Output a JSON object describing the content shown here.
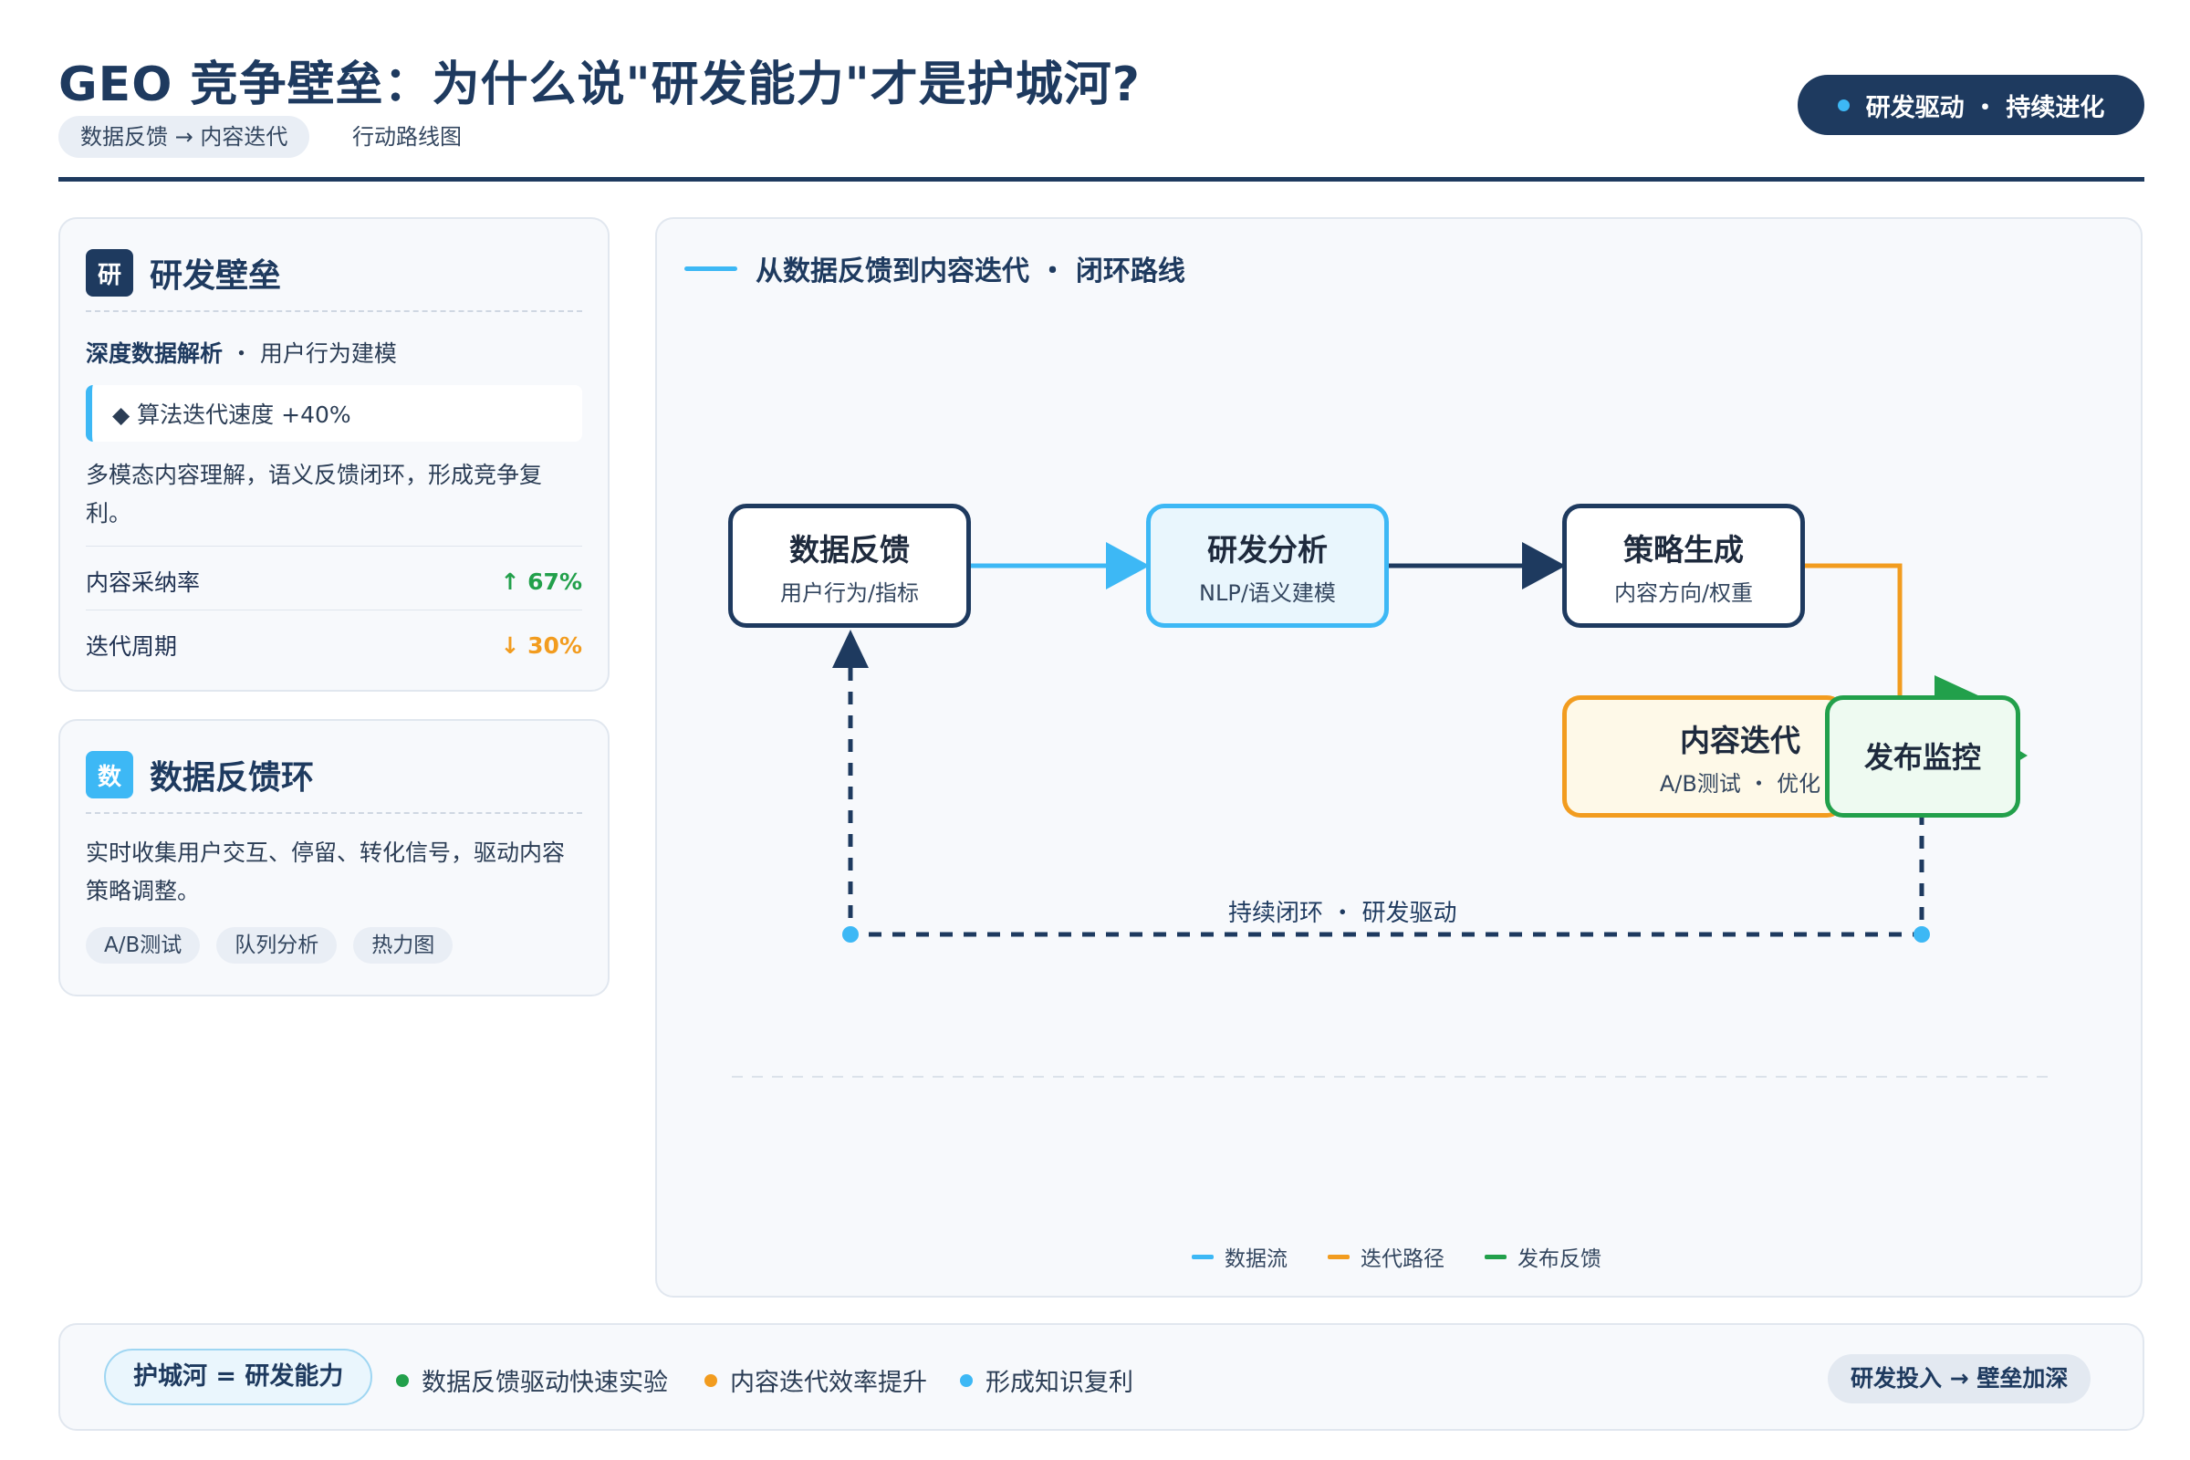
{
  "header": {
    "title": "GEO 竞争壁垒：为什么说\"研发能力\"才是护城河?",
    "pill": "数据反馈 → 内容迭代",
    "subtitle": "行动路线图",
    "badge": "研发驱动 ・ 持续进化"
  },
  "card_rd": {
    "icon": "研",
    "title": "研发壁垒",
    "subtitle_bold": "深度数据解析",
    "subtitle_rest": " ・ 用户行为建模",
    "highlight": "◆ 算法迭代速度 +40%",
    "paragraph": "多模态内容理解，语义反馈闭环，形成竞争复利。",
    "stats": [
      {
        "label": "内容采纳率",
        "value": "↑ 67%",
        "color": "#22a04b"
      },
      {
        "label": "迭代周期",
        "value": "↓ 30%",
        "color": "#f29c1f"
      }
    ]
  },
  "card_feedback": {
    "icon": "数",
    "title": "数据反馈环",
    "paragraph": "实时收集用户交互、停留、转化信号，驱动内容策略调整。",
    "tags": [
      "A/B测试",
      "队列分析",
      "热力图"
    ]
  },
  "diagram": {
    "title": "从数据反馈到内容迭代 ・ 闭环路线",
    "nodes": {
      "feedback": {
        "title": "数据反馈",
        "sub": "用户行为/指标"
      },
      "analysis": {
        "title": "研发分析",
        "sub": "NLP/语义建模"
      },
      "strategy": {
        "title": "策略生成",
        "sub": "内容方向/权重"
      },
      "iterate": {
        "title": "内容迭代",
        "sub": "A/B测试 ・ 优化"
      },
      "monitor": {
        "title": "发布监控",
        "sub": ""
      }
    },
    "loop_label": "持续闭环 ・ 研发驱动",
    "legend": [
      {
        "label": "数据流",
        "color": "#3db8f5"
      },
      {
        "label": "迭代路径",
        "color": "#f29c1f"
      },
      {
        "label": "发布反馈",
        "color": "#22a04b"
      }
    ]
  },
  "footer": {
    "moat": "护城河 = 研发能力",
    "bullets": [
      {
        "text": "数据反馈驱动快速实验",
        "color": "#22a04b"
      },
      {
        "text": "内容迭代效率提升",
        "color": "#f29c1f"
      },
      {
        "text": "形成知识复利",
        "color": "#3db8f5"
      }
    ],
    "pill": "研发投入 → 壁垒加深"
  },
  "colors": {
    "navy": "#1e3a5f",
    "sky": "#3db8f5",
    "orange": "#f29c1f",
    "green": "#22a04b"
  }
}
